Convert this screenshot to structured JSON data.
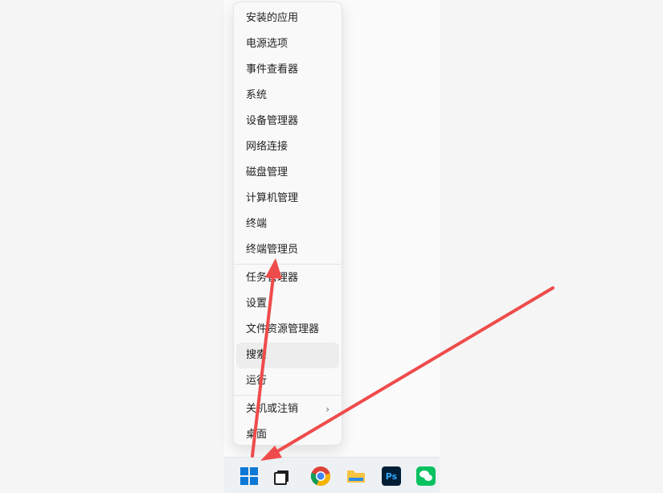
{
  "context_menu": {
    "items": [
      {
        "label": "安装的应用"
      },
      {
        "label": "电源选项"
      },
      {
        "label": "事件查看器"
      },
      {
        "label": "系统"
      },
      {
        "label": "设备管理器"
      },
      {
        "label": "网络连接"
      },
      {
        "label": "磁盘管理"
      },
      {
        "label": "计算机管理"
      },
      {
        "label": "终端"
      },
      {
        "label": "终端管理员"
      },
      {
        "label": "任务管理器"
      },
      {
        "label": "设置"
      },
      {
        "label": "文件资源管理器"
      },
      {
        "label": "搜索"
      },
      {
        "label": "运行"
      },
      {
        "label": "关机或注销"
      },
      {
        "label": "桌面"
      }
    ],
    "submenu_chevron": "›"
  },
  "taskbar": {
    "ps_label": "Ps"
  },
  "colors": {
    "annotation_arrow": "#ef4b4b",
    "start_blue": "#0a78d4",
    "folder_yellow": "#f6c342"
  },
  "icons": [
    "windows-start-icon",
    "task-view-icon",
    "chrome-icon",
    "file-explorer-icon",
    "photoshop-icon",
    "wechat-icon",
    "chevron-right-icon"
  ]
}
